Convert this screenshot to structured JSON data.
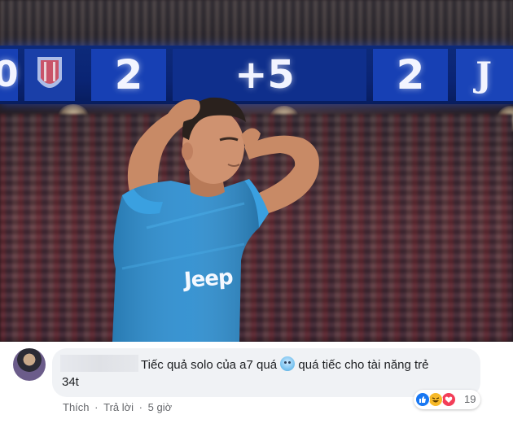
{
  "photo": {
    "scoreboard": {
      "home_score": "2",
      "diff": "+5",
      "away_score": "2",
      "edge_left": "0",
      "away_letter": "J"
    },
    "jersey_text": "Jeep"
  },
  "comment": {
    "text_line1": "Tiếc quả solo của a7 quá",
    "text_line1b": "quá tiếc cho tài năng trẻ",
    "text_line2": "34t",
    "emoji_icon": "sweat-face-icon"
  },
  "actions": {
    "like": "Thích",
    "sep1": "·",
    "reply": "Trả lời",
    "sep2": "·",
    "time": "5 giờ"
  },
  "reactions": {
    "icons": [
      "like-icon",
      "haha-icon",
      "love-icon"
    ],
    "count": "19",
    "colors": {
      "like": "#1877f2",
      "haha": "#f7b928",
      "love": "#f33e58"
    }
  }
}
